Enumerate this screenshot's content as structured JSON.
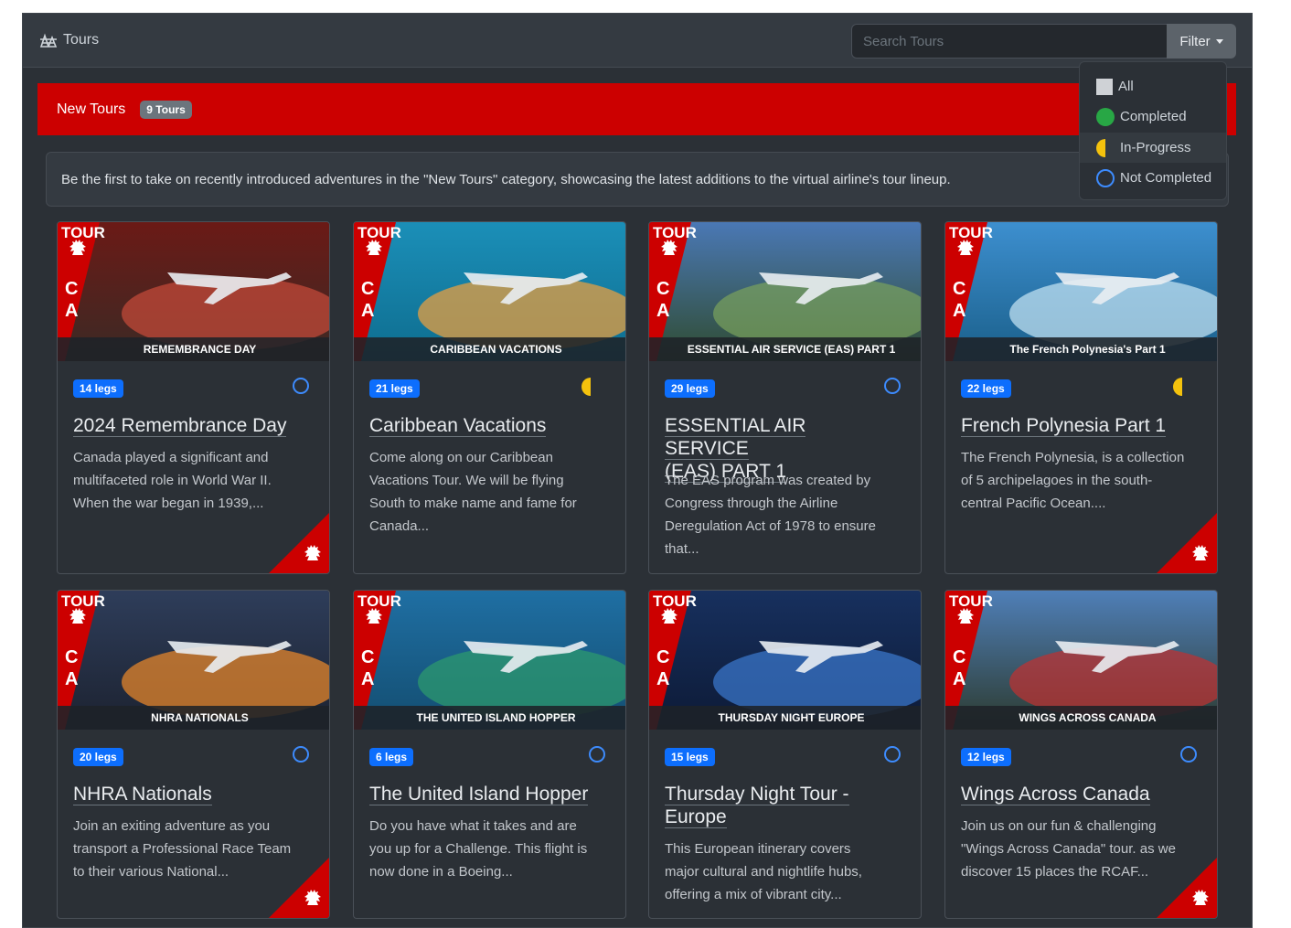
{
  "topbar": {
    "title": "Tours",
    "search_placeholder": "Search Tours",
    "filter_label": "Filter"
  },
  "filter_menu": {
    "items": [
      {
        "label": "All",
        "icon": "square-icon",
        "color": "#cfd2d6"
      },
      {
        "label": "Completed",
        "icon": "green-dot-icon",
        "color": "#28a745"
      },
      {
        "label": "In-Progress",
        "icon": "half-circle-icon",
        "color": "#f4c20d"
      },
      {
        "label": "Not Completed",
        "icon": "ring-icon",
        "color": "#3d8bfd"
      }
    ]
  },
  "category": {
    "title": "New Tours",
    "count_badge": "9 Tours",
    "description": "Be the first to take on recently introduced adventures in the \"New Tours\" category, showcasing the latest additions to the virtual airline's tour lineup."
  },
  "colors": {
    "accent": "#cc0000",
    "badge": "#0d6efd",
    "progress": "#f4c20d",
    "not_completed": "#3d8bfd"
  },
  "image_overlay": {
    "tour_label": "TOUR",
    "country_letters": [
      "C",
      "A"
    ]
  },
  "cards": [
    {
      "caption": "REMEMBRANCE DAY",
      "legs": "14 legs",
      "status": "not-completed",
      "title": "2024 Remembrance Day",
      "text_lines": [
        "Canada played a significant and",
        "multifaceted role in World War II.",
        "When the war began in 1939,..."
      ]
    },
    {
      "caption": "CARIBBEAN VACATIONS",
      "legs": "21 legs",
      "status": "in-progress",
      "title": "Caribbean Vacations",
      "text_lines": [
        "Come along on our Caribbean",
        "Vacations Tour. We will be flying",
        "South to make name and fame for",
        "Canada..."
      ]
    },
    {
      "caption": "ESSENTIAL AIR SERVICE (EAS) PART 1",
      "legs": "29 legs",
      "status": "not-completed",
      "title_lines": [
        "ESSENTIAL AIR SERVICE",
        "(EAS) PART 1"
      ],
      "text_lines": [
        "The EAS program was created by",
        "Congress through the Airline",
        "Deregulation Act of 1978 to ensure",
        "that..."
      ]
    },
    {
      "caption": "The French Polynesia's Part 1",
      "legs": "22 legs",
      "status": "in-progress",
      "title": "French Polynesia Part 1",
      "text_lines": [
        "The French Polynesia, is a collection",
        "of 5 archipelagoes in the south-",
        "central Pacific Ocean...."
      ]
    },
    {
      "caption": "NHRA NATIONALS",
      "legs": "20 legs",
      "status": "not-completed",
      "title": "NHRA Nationals",
      "text_lines": [
        "Join an exiting adventure as you",
        "transport a Professional Race Team",
        "to their various National..."
      ]
    },
    {
      "caption": "THE UNITED ISLAND HOPPER",
      "legs": "6 legs",
      "status": "not-completed",
      "title": "The United Island Hopper",
      "text_lines": [
        "Do you have what it takes and are",
        "you up for a Challenge. This flight is",
        "now done in a Boeing..."
      ]
    },
    {
      "caption": "THURSDAY NIGHT EUROPE",
      "legs": "15 legs",
      "status": "not-completed",
      "title_lines": [
        "Thursday Night Tour -",
        "Europe"
      ],
      "text_lines": [
        "This European itinerary covers",
        "major cultural and nightlife hubs,",
        "offering a mix of vibrant city..."
      ]
    },
    {
      "caption": "WINGS ACROSS CANADA",
      "legs": "12 legs",
      "status": "not-completed",
      "title": "Wings Across Canada",
      "text_lines": [
        "Join us on our fun & challenging",
        "\"Wings Across Canada\" tour. as we",
        "discover 15 places the RCAF..."
      ]
    }
  ]
}
